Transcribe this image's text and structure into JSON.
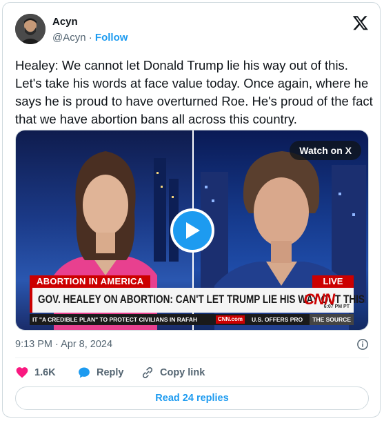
{
  "author": {
    "name": "Acyn",
    "handle": "@Acyn",
    "separator": "·",
    "follow_label": "Follow"
  },
  "tweet_text": "Healey: We cannot let Donald Trump lie his way out of this. Let's take his words at face value today. Once again, where he says he is proud to have overturned Roe. He's proud of the fact that we have abortion bans all across this country.",
  "media": {
    "watch_label": "Watch on X",
    "chyron_section": "ABORTION IN AMERICA",
    "live_label": "LIVE",
    "headline": "GOV. HEALEY ON ABORTION: CAN'T LET TRUMP LIE HIS WAY OUT THIS",
    "network_logo": "CNN",
    "broadcast_time": "6:07 PM PT",
    "ticker_left": "IT \"A CREDIBLE PLAN\" TO PROTECT CIVILIANS IN RAFAH",
    "ticker_brand": "CNN.com",
    "ticker_right": "U.S. OFFERS PRO",
    "ticker_source": "THE SOURCE"
  },
  "timestamp": "9:13 PM · Apr 8, 2024",
  "actions": {
    "like_count": "1.6K",
    "reply_label": "Reply",
    "copy_label": "Copy link"
  },
  "read_replies_label": "Read 24 replies",
  "colors": {
    "accent": "#1d9bf0",
    "like": "#f91880",
    "cnn_red": "#cc0000"
  }
}
